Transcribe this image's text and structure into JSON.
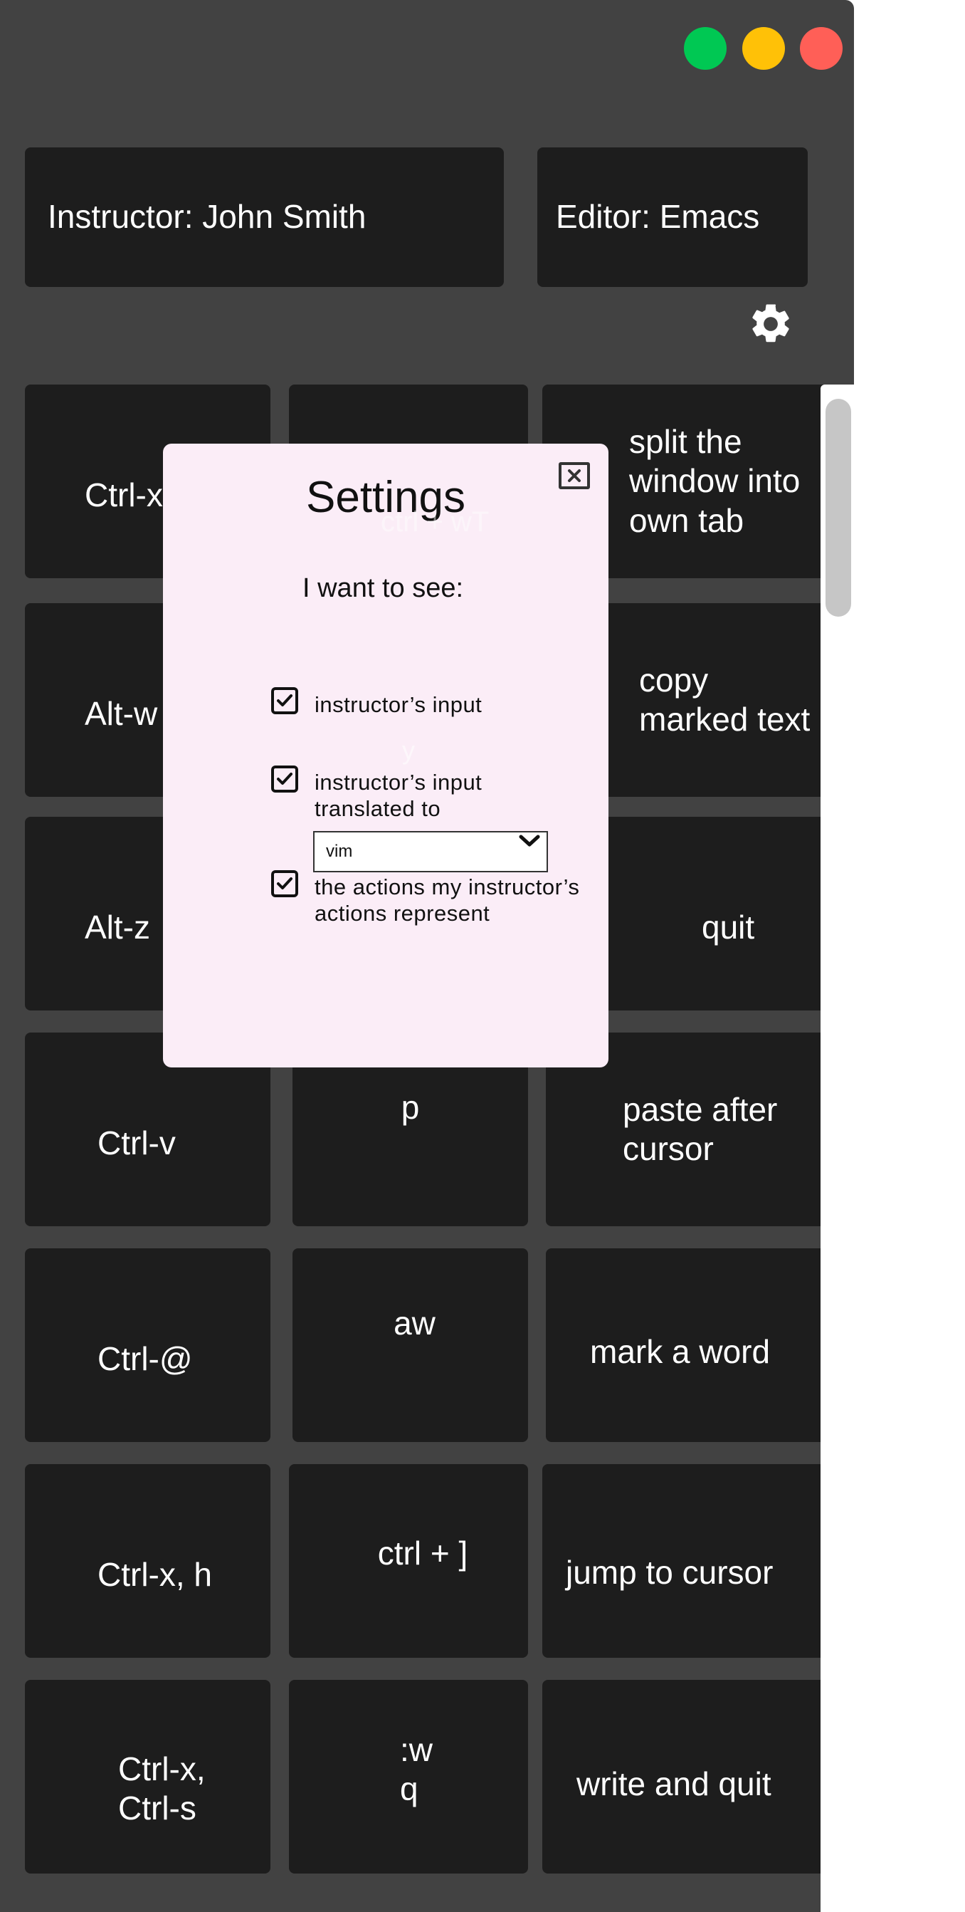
{
  "window": {
    "controls": {
      "green": "#00c853",
      "yellow": "#ffc107",
      "red": "#ff5f57"
    },
    "background": "#424242"
  },
  "header": {
    "instructor": "Instructor: John Smith",
    "editor": "Editor: Emacs",
    "settings_icon": "gear-icon"
  },
  "grid": {
    "rows": [
      [
        "Ctrl-x",
        "ctrl + wT",
        "split the\nwindow into\nown tab"
      ],
      [
        "Alt-w",
        "y",
        "copy\nmarked text"
      ],
      [
        "Alt-z",
        "",
        "quit"
      ],
      [
        "Ctrl-v",
        "p",
        "paste after\ncursor"
      ],
      [
        "Ctrl-@",
        "aw",
        "mark a word"
      ],
      [
        "Ctrl-x, h",
        "ctrl + ]",
        "jump to cursor"
      ],
      [
        "Ctrl-x,\nCtrl-s",
        ":w\nq",
        "write and quit"
      ]
    ]
  },
  "settings_modal": {
    "title": "Settings",
    "subtitle": "I want to see:",
    "close_icon": "close-icon",
    "options": [
      {
        "label": "instructor’s input",
        "checked": true
      },
      {
        "label": "instructor’s input\ntranslated to",
        "checked": true
      },
      {
        "label": "the actions my instructor’s\nactions represent",
        "checked": true
      }
    ],
    "translate_select": {
      "value": "vim"
    }
  }
}
